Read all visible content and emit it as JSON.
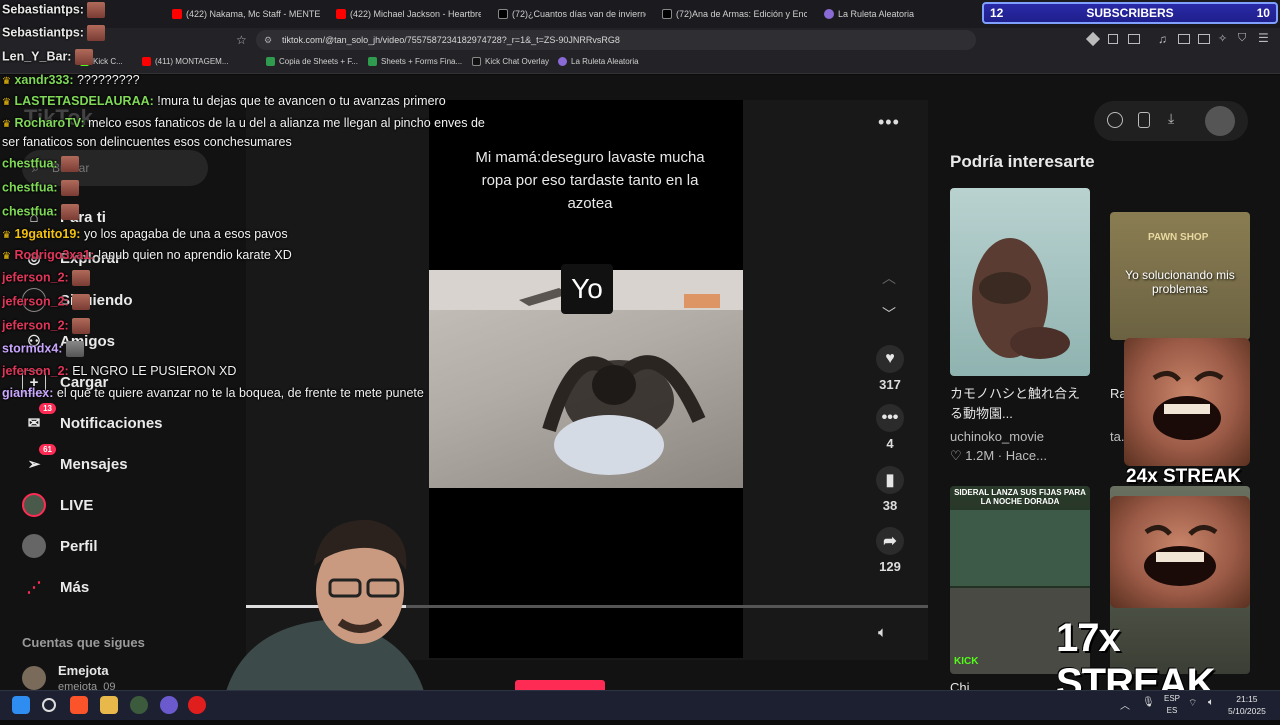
{
  "browser": {
    "tabs": [
      {
        "label": "(422) Nakama, Mc Staff - MENTE M/",
        "color": "#ff0000"
      },
      {
        "label": "(422) Michael Jackson - Heartbreak",
        "color": "#ff0000"
      },
      {
        "label": "(72)¿Cuantos días van de invierno? Y",
        "color": "#000000"
      },
      {
        "label": "(72)Ana de Armas: Edición y Encant",
        "color": "#000000"
      },
      {
        "label": "La Ruleta Aleatoria",
        "color": "#8a6bd6"
      }
    ],
    "url": "tiktok.com/@tan_solo_jh/video/7557587234182974728?_r=1&_t=ZS-90JNRRvsRG8",
    "bookmarks": [
      "Kick C...",
      "(411) MONTAGEM...",
      "Copia de Sheets + F...",
      "Sheets + Forms Fina...",
      "Kick Chat Overlay",
      "La Ruleta Aleatoria"
    ]
  },
  "subscribers_bar": {
    "left": "12",
    "label": "SUBSCRIBERS",
    "right": "10"
  },
  "sidebar": {
    "logo": "TikTok",
    "search_placeholder": "Buscar",
    "items": [
      {
        "label": "Para ti"
      },
      {
        "label": "Explorar"
      },
      {
        "label": "Siguiendo"
      },
      {
        "label": "Amigos"
      },
      {
        "label": "Cargar"
      },
      {
        "label": "Notificaciones",
        "badge": "13"
      },
      {
        "label": "Mensajes",
        "badge": "61"
      },
      {
        "label": "LIVE"
      },
      {
        "label": "Perfil"
      },
      {
        "label": "Más"
      }
    ],
    "following_title": "Cuentas que sigues",
    "following": [
      {
        "name": "Emejota",
        "handle": "emejota_09"
      }
    ]
  },
  "video": {
    "caption": "Mi mamá:deseguro lavaste mucha ropa por eso tardaste tanto en la azotea",
    "overlay_label": "Yo",
    "likes": "317",
    "comments": "4",
    "saves": "38",
    "shares": "129",
    "more_label": "•••"
  },
  "right_panel": {
    "title": "Podría interesarte",
    "cards": [
      {
        "title": "カモノハシと触れ合える動物園...",
        "author": "uchinoko_movie",
        "views": "1.2M",
        "time": "Hace..."
      },
      {
        "title": "Ra...",
        "author": "ta...",
        "views": "",
        "time": ""
      },
      {
        "title": "Chi...",
        "author": "",
        "views": "",
        "time": ""
      },
      {
        "title": "",
        "author": "",
        "views": "",
        "time": ""
      }
    ],
    "thumb_texts": {
      "meme": "Yo solucionando mis problemas",
      "sign": "PAWN SHOP",
      "kick_caption": "SIDERAL LANZA SUS FIJAS PARA LA NOCHE DORADA",
      "kick_logo": "KICK"
    }
  },
  "chat": [
    {
      "user": "Sebastiantps:",
      "msg": "",
      "color": "#e8e8e8"
    },
    {
      "user": "Sebastiantps:",
      "msg": "",
      "color": "#e8e8e8"
    },
    {
      "user": "Len_Y_Bar:",
      "msg": "",
      "color": "#e8e8e8"
    },
    {
      "user": "xandr333:",
      "msg": "?????????",
      "color": "#7fd957"
    },
    {
      "user": "LASTETASDELAURAA:",
      "msg": "!mura tu dejas que te avancen o tu avanzas primero",
      "color": "#7fd957"
    },
    {
      "user": "RocharoTV:",
      "msg": "melco esos fanaticos de la u del a alianza me llegan al pincho enves de",
      "color": "#7fd957"
    },
    {
      "user": "",
      "msg": "ser fanaticos son delincuentes esos conchesumares",
      "color": "#e8e8e8"
    },
    {
      "user": "chestfua:",
      "msg": "",
      "color": "#7fd957"
    },
    {
      "user": "chestfua:",
      "msg": "",
      "color": "#7fd957"
    },
    {
      "user": "chestfua:",
      "msg": "",
      "color": "#7fd957"
    },
    {
      "user": "19gatito19:",
      "msg": "yo los apagaba de una a esos pavos",
      "color": "#f4c20d"
    },
    {
      "user": "Rodrigo3xa1:",
      "msg": "!anub quien no aprendio karate XD",
      "color": "#e0365a"
    },
    {
      "user": "jeferson_2:",
      "msg": "",
      "color": "#e0365a"
    },
    {
      "user": "jeferson_2:",
      "msg": "",
      "color": "#e0365a"
    },
    {
      "user": "jeferson_2:",
      "msg": "",
      "color": "#e0365a"
    },
    {
      "user": "stormdx4:",
      "msg": "",
      "color": "#c9a6ff"
    },
    {
      "user": "jeferson_2:",
      "msg": "EL NGRO LE PUSIERON XD",
      "color": "#e0365a"
    },
    {
      "user": "gianflex:",
      "msg": "el que te quiere avanzar no te la boquea, de frente te mete punete",
      "color": "#c9a6ff"
    }
  ],
  "streaks": {
    "first": "24x STREAK",
    "second": "17x STREAK"
  },
  "taskbar": {
    "lang_top": "ESP",
    "lang_bottom": "ES",
    "time": "21:15",
    "date": "5/10/2025"
  }
}
